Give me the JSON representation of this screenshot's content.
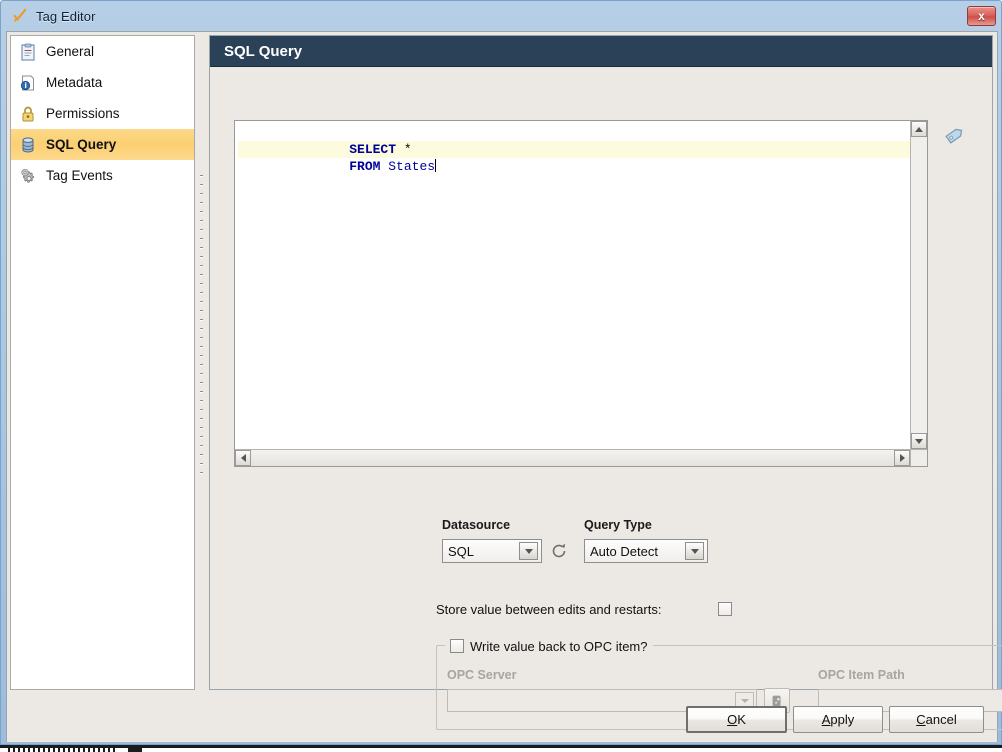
{
  "window": {
    "title": "Tag Editor",
    "title_icon": "checkmark-pencil-icon",
    "close_label": "x"
  },
  "sidebar": {
    "items": [
      {
        "label": "General",
        "icon": "clipboard-icon",
        "selected": false
      },
      {
        "label": "Metadata",
        "icon": "info-icon",
        "selected": false
      },
      {
        "label": "Permissions",
        "icon": "lock-icon",
        "selected": false
      },
      {
        "label": "SQL Query",
        "icon": "database-icon",
        "selected": true
      },
      {
        "label": "Tag Events",
        "icon": "gears-icon",
        "selected": false
      }
    ]
  },
  "panel": {
    "header_title": "SQL Query",
    "tag_icon": "tag-icon"
  },
  "editor": {
    "lines": [
      {
        "tokens": [
          {
            "t": "SELECT",
            "c": "kw"
          },
          {
            "t": " ",
            "c": "plain"
          },
          {
            "t": "*",
            "c": "plain"
          }
        ],
        "current": false
      },
      {
        "tokens": [
          {
            "t": "FROM",
            "c": "kw"
          },
          {
            "t": " ",
            "c": "plain"
          },
          {
            "t": "States",
            "c": "ident"
          }
        ],
        "current": true
      }
    ],
    "full_text": "SELECT *\nFROM States",
    "caret_line": 2
  },
  "datasource": {
    "label": "Datasource",
    "value": "SQL",
    "refresh_icon": "refresh-icon"
  },
  "query_type": {
    "label": "Query Type",
    "value": "Auto Detect"
  },
  "store_value": {
    "label": "Store value between edits and restarts:",
    "checked": false
  },
  "opc_group": {
    "legend": "Write value back to OPC item?",
    "legend_checked": false,
    "enabled": false,
    "server": {
      "label": "OPC Server",
      "value": "",
      "browse_icon": "browse-opc-icon"
    },
    "item_path": {
      "label": "OPC Item Path",
      "value": "",
      "add_icon": "plus-icon"
    }
  },
  "buttons": {
    "ok": {
      "before": "",
      "mnemonic": "O",
      "after": "K",
      "focused": true
    },
    "apply": {
      "before": "",
      "mnemonic": "A",
      "after": "pply",
      "focused": false
    },
    "cancel": {
      "before": "",
      "mnemonic": "C",
      "after": "ancel",
      "focused": false
    }
  },
  "colors": {
    "header_navy": "#2b4158",
    "selection_gold": "#fbcf72",
    "keyword_blue": "#00009b",
    "current_line": "#fdfbdd",
    "titlebar_blue": "#a8c6e2"
  }
}
